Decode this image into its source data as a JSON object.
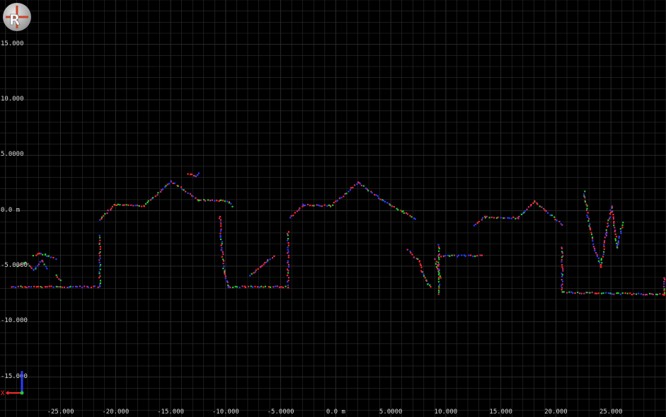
{
  "app": {
    "logo": "ros-logo"
  },
  "colors": {
    "background": "#000000",
    "grid": "#2e2e2e",
    "label": "#d8d8d8",
    "red": "#ff2a2a",
    "green": "#22cc33",
    "blue": "#2a3cff",
    "magenta": "#c03080"
  },
  "axes": {
    "y_labels": [
      "15.000",
      "10.000",
      "5.0000",
      "0.0 m",
      "-5.0000",
      "-10.000",
      "-15.000"
    ],
    "x_labels": [
      "-25.000",
      "-20.000",
      "-15.000",
      "-10.000",
      "-5.0000",
      "0.0 m",
      "5.0000",
      "10.000",
      "15.000",
      "20.000",
      "25.000"
    ],
    "gizmo": {
      "x_label": "X",
      "x_color": "#ff2a2a",
      "y_color": "#22cc33"
    }
  },
  "chart_data": {
    "type": "scatter",
    "xlim": [
      -30.5,
      30
    ],
    "ylim": [
      -18.6,
      19
    ],
    "grid": true,
    "units": "m",
    "traces": [
      {
        "x": [
          -29.5,
          -21.5
        ],
        "y": [
          -6.8,
          -6.8
        ]
      },
      {
        "x": [
          -29,
          -28.2,
          -27.5,
          -26.8,
          -26.3
        ],
        "y": [
          -5.0,
          -4.6,
          -5.3,
          -4.4,
          -5.1
        ]
      },
      {
        "x": [
          -27.5,
          -27.0,
          -26.5,
          -25.5
        ],
        "y": [
          -4.0,
          -3.8,
          -3.9,
          -4.3
        ]
      },
      {
        "x": [
          -25.5,
          -25.0
        ],
        "y": [
          -5.8,
          -6.2
        ]
      },
      {
        "x": [
          -21.5,
          -21.5
        ],
        "y": [
          -6.8,
          -2.2
        ]
      },
      {
        "x": [
          -21.5,
          -20.2,
          -17.5,
          -15.0,
          -12.5,
          -10.5,
          -9.7,
          -9.5
        ],
        "y": [
          -0.8,
          0.6,
          0.5,
          2.7,
          1.0,
          1.0,
          0.8,
          0.5
        ]
      },
      {
        "x": [
          -13.5,
          -12.8,
          -12.5
        ],
        "y": [
          3.4,
          3.2,
          3.5
        ]
      },
      {
        "x": [
          -10.6,
          -10.4,
          -10.2,
          -9.8
        ],
        "y": [
          -0.4,
          -3.5,
          -5.5,
          -6.8
        ]
      },
      {
        "x": [
          -9.8,
          -4.4
        ],
        "y": [
          -6.8,
          -6.8
        ]
      },
      {
        "x": [
          -7.8,
          -7.4,
          -6.8,
          -6.2,
          -5.7
        ],
        "y": [
          -5.8,
          -5.4,
          -4.9,
          -4.4,
          -4.0
        ]
      },
      {
        "x": [
          -4.4,
          -4.4
        ],
        "y": [
          -6.8,
          -1.8
        ]
      },
      {
        "x": [
          -4.2,
          -3.0,
          -0.5,
          2.0,
          4.2,
          6.0,
          7.2
        ],
        "y": [
          -0.6,
          0.6,
          0.5,
          2.6,
          1.0,
          0.0,
          -0.7
        ]
      },
      {
        "x": [
          6.5,
          7.5,
          7.8,
          8.3,
          8.6
        ],
        "y": [
          -3.5,
          -4.5,
          -5.5,
          -6.5,
          -6.8
        ]
      },
      {
        "x": [
          9.0,
          9.2,
          9.5
        ],
        "y": [
          -4.3,
          -5.2,
          -6.0
        ]
      },
      {
        "x": [
          9.3,
          9.3
        ],
        "y": [
          -3.0,
          -7.5
        ]
      },
      {
        "x": [
          9.3,
          13.2
        ],
        "y": [
          -4.0,
          -4.0
        ]
      },
      {
        "x": [
          12.5,
          13.5,
          16.5,
          18.0,
          20.5
        ],
        "y": [
          -1.3,
          -0.5,
          -0.6,
          0.9,
          -1.2
        ]
      },
      {
        "x": [
          20.5,
          20.5
        ],
        "y": [
          -3.2,
          -7.3
        ]
      },
      {
        "x": [
          20.5,
          29.8
        ],
        "y": [
          -7.3,
          -7.5
        ]
      },
      {
        "x": [
          29.8,
          29.8
        ],
        "y": [
          -6.0,
          -7.5
        ]
      },
      {
        "x": [
          22.5,
          23.0,
          23.5,
          24.0,
          24.5,
          25.0,
          25.5,
          26.0
        ],
        "y": [
          1.8,
          -1.5,
          -3.5,
          -5.0,
          -2.0,
          0.5,
          -3.2,
          -1.0
        ]
      }
    ]
  }
}
